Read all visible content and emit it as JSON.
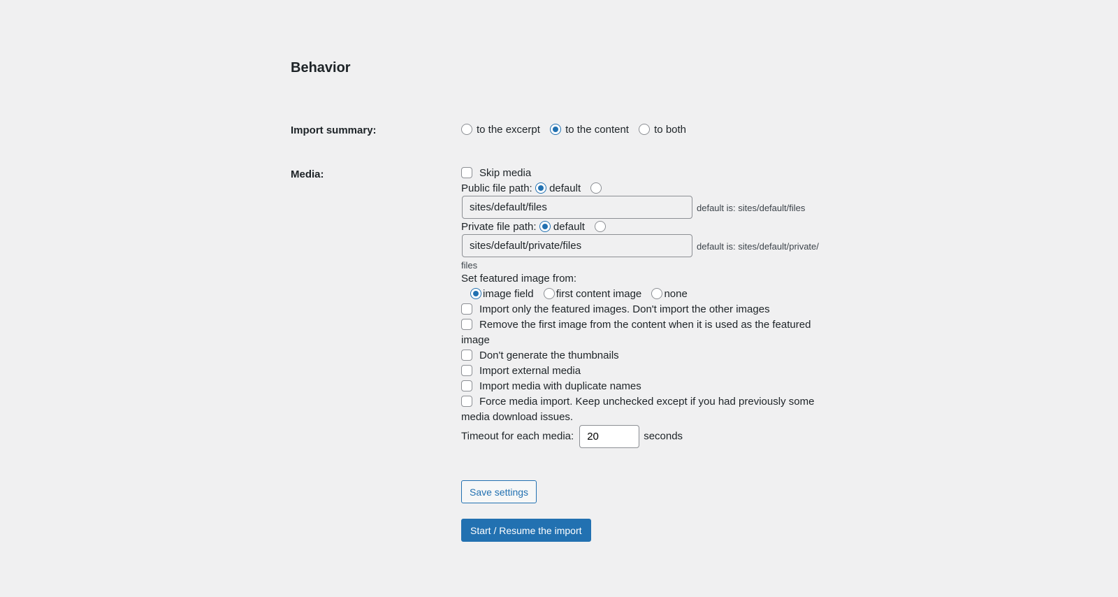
{
  "section_title": "Behavior",
  "import_summary": {
    "label": "Import summary:",
    "options": [
      {
        "label": "to the excerpt",
        "checked": false
      },
      {
        "label": "to the content",
        "checked": true
      },
      {
        "label": "to both",
        "checked": false
      }
    ]
  },
  "media": {
    "label": "Media:",
    "skip_media": {
      "label": "Skip media",
      "checked": false
    },
    "public_path": {
      "label": "Public file path:",
      "default_label": "default",
      "default_checked": true,
      "value": "sites/default/files",
      "hint": "default is: sites/default/files"
    },
    "private_path": {
      "label": "Private file path:",
      "default_label": "default",
      "default_checked": true,
      "value": "sites/default/private/files",
      "hint": "default is: sites/default/private/",
      "hint_wrap": "files"
    },
    "featured": {
      "label": "Set featured image from:",
      "options": [
        {
          "label": "image field",
          "checked": true
        },
        {
          "label": "first content image",
          "checked": false
        },
        {
          "label": "none",
          "checked": false
        }
      ]
    },
    "checkboxes": [
      {
        "label": "Import only the featured images. Don't import the other images",
        "checked": false
      },
      {
        "label": "Remove the first image from the content when it is used as the featured",
        "wrap": "image",
        "checked": false
      },
      {
        "label": "Don't generate the thumbnails",
        "checked": false
      },
      {
        "label": "Import external media",
        "checked": false
      },
      {
        "label": "Import media with duplicate names",
        "checked": false
      },
      {
        "label": "Force media import. Keep unchecked except if you had previously some",
        "wrap": "media download issues.",
        "checked": false
      }
    ],
    "timeout": {
      "label": "Timeout for each media:",
      "value": "20",
      "unit": "seconds"
    }
  },
  "buttons": {
    "save": "Save settings",
    "start": "Start / Resume the import"
  }
}
